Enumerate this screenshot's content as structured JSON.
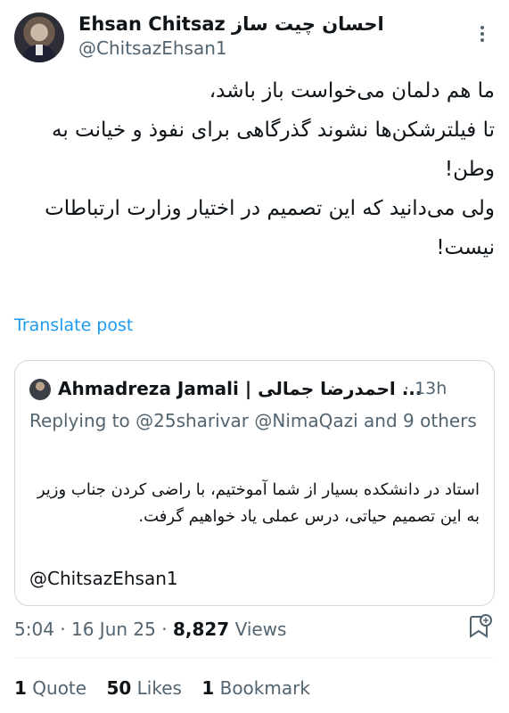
{
  "author": {
    "display_name": "Ehsan Chitsaz احسان چیت ساز",
    "handle": "@ChitsazEhsan1"
  },
  "post": {
    "lines": [
      "ما هم دلمان می‌خواست باز باشد،",
      "تا فیلترشکن‌ها نشوند گذرگاهی برای نفوذ و خیانت به وطن!",
      "ولی می‌دانید که این تصمیم در اختیار وزارت ارتباطات نیست!"
    ],
    "translate_label": "Translate post"
  },
  "quoted": {
    "name": "Ahmadreza Jamali | احمدرضا جمالی ...",
    "time": "· 13h",
    "reply_prefix": "Replying to ",
    "reply_mentions": "@25sharivar @NimaQazi",
    "reply_suffix": " and 9 others",
    "text": "استاد در دانشکده بسیار از شما آموختیم، با راضی کردن جناب وزیر به این تصمیم حیاتی، درس عملی یاد خواهیم گرفت.",
    "mention": "@ChitsazEhsan1"
  },
  "meta": {
    "time": "5:04",
    "date": "16 Jun 25",
    "views_count": "8,827",
    "views_label": "Views"
  },
  "stats": {
    "quotes_count": "1",
    "quotes_label": "Quote",
    "likes_count": "50",
    "likes_label": "Likes",
    "bookmarks_count": "1",
    "bookmarks_label": "Bookmark"
  },
  "icons": {
    "more": "more-horizontal-icon",
    "bookmark": "bookmark-menu-icon"
  }
}
